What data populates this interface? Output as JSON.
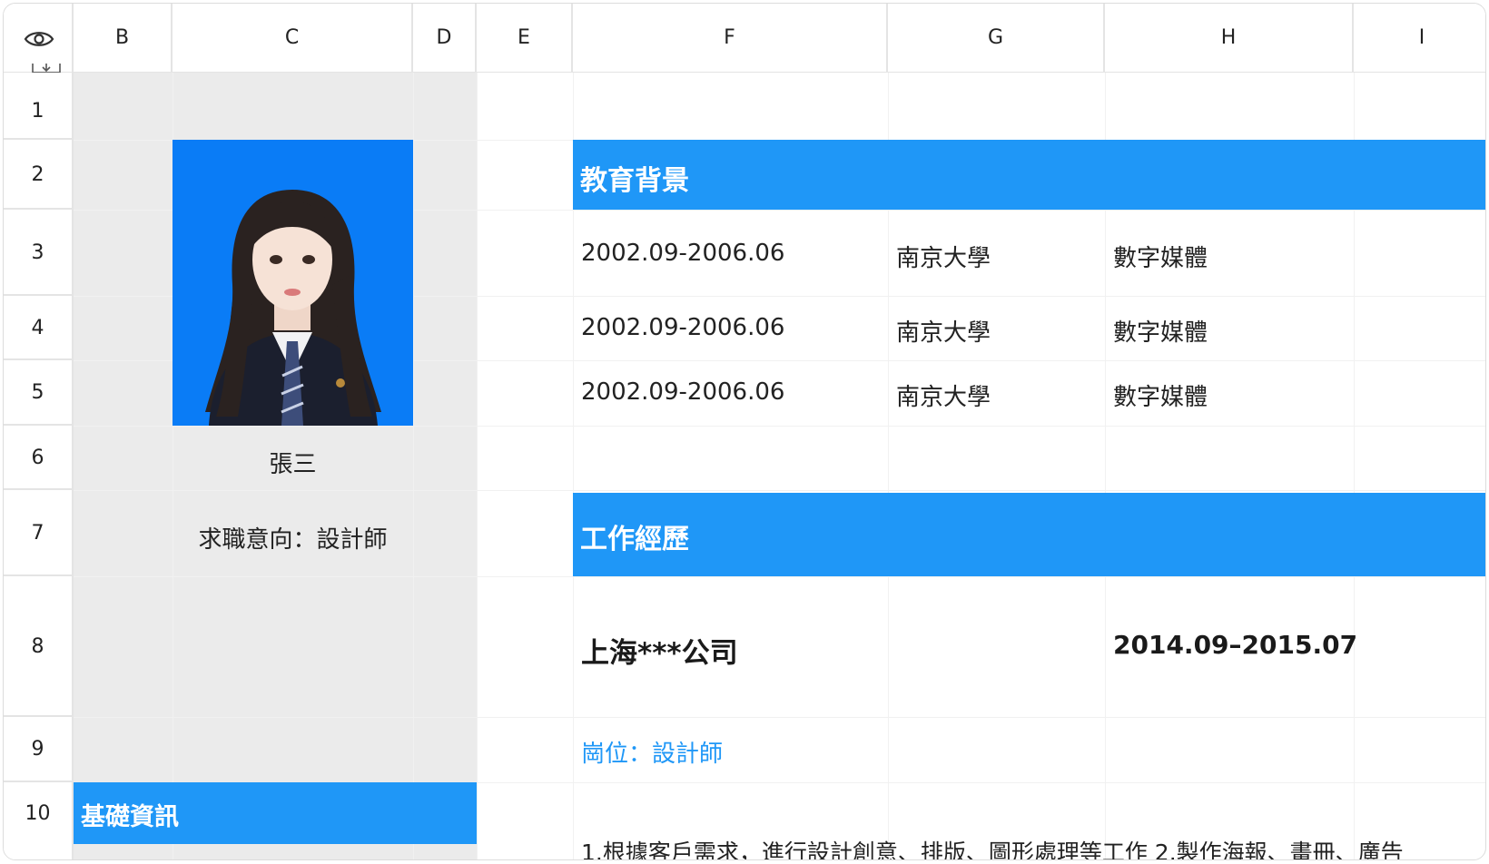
{
  "columns": [
    "B",
    "C",
    "D",
    "E",
    "F",
    "G",
    "H",
    "I"
  ],
  "rows": [
    "1",
    "2",
    "3",
    "4",
    "5",
    "6",
    "7",
    "8",
    "9",
    "10"
  ],
  "profile": {
    "name": "張三",
    "intent": "求職意向：設計師",
    "basic_info_label": "基礎資訊"
  },
  "education": {
    "title": "教育背景",
    "entries": [
      {
        "period": "2002.09-2006.06",
        "school": "南京大學",
        "major": "數字媒體"
      },
      {
        "period": "2002.09-2006.06",
        "school": "南京大學",
        "major": "數字媒體"
      },
      {
        "period": "2002.09-2006.06",
        "school": "南京大學",
        "major": "數字媒體"
      }
    ]
  },
  "work": {
    "title": "工作經歷",
    "company": "上海***公司",
    "period": "2014.09–2015.07",
    "position": "崗位：設計師",
    "description": "1.根據客戶需求，進行設計創意、排版、圖形處理等工作 2.製作海報、畫冊、廣告"
  },
  "colors": {
    "accent_blue": "#1f97f7",
    "photo_bg": "#0a7cf6",
    "sidebar_gray": "#ebebeb",
    "position_text": "#1f97f7"
  },
  "icons": {
    "corner": "eye-icon",
    "freeze": "freeze-rows-icon"
  }
}
